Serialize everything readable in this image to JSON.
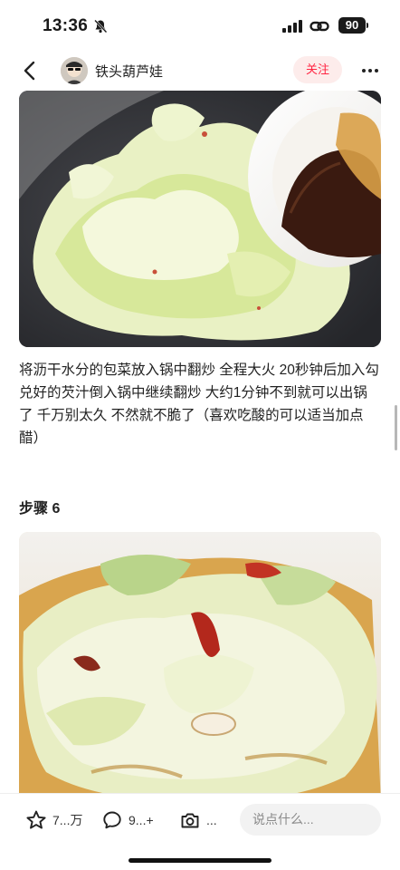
{
  "status_bar": {
    "time": "13:36",
    "battery": "90",
    "icons": [
      "bell-off-icon",
      "signal-icon",
      "link-icon",
      "battery-icon"
    ]
  },
  "header": {
    "author": "铁头葫芦娃",
    "follow_label": "关注",
    "icons": [
      "back-arrow-icon",
      "more-icon"
    ]
  },
  "content": {
    "step_description": "将沥干水分的包菜放入锅中翻炒 全程大火 20秒钟后加入勾兑好的芡汁倒入锅中继续翻炒 大约1分钟不到就可以出锅了 千万别太久 不然就不脆了（喜欢吃酸的可以适当加点醋）",
    "next_step_title": "步骤 6"
  },
  "bottom_bar": {
    "like_count": "7...万",
    "comment_count": "9...+",
    "collect_count": "...",
    "comment_placeholder": "说点什么...",
    "accent_color": "#ff2442"
  }
}
